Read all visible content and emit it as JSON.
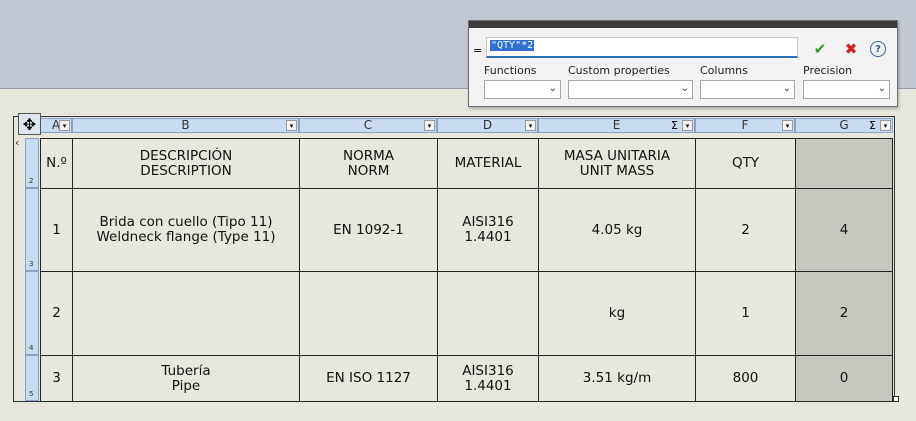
{
  "formula_bar": {
    "equals": "=",
    "expression": "\"QTY\"*2",
    "labels": {
      "functions": "Functions",
      "custom_properties": "Custom properties",
      "columns": "Columns",
      "precision": "Precision"
    },
    "buttons": {
      "ok": "✔",
      "cancel": "✖",
      "help": "?"
    }
  },
  "table": {
    "move_handle": "✥",
    "row_back_arrow": "‹",
    "columns": [
      {
        "letter": "A",
        "sigma": ""
      },
      {
        "letter": "B",
        "sigma": ""
      },
      {
        "letter": "C",
        "sigma": ""
      },
      {
        "letter": "D",
        "sigma": ""
      },
      {
        "letter": "E",
        "sigma": "Σ"
      },
      {
        "letter": "F",
        "sigma": ""
      },
      {
        "letter": "G",
        "sigma": "Σ"
      }
    ],
    "row_numbers": [
      "2",
      "3",
      "4",
      "5"
    ],
    "header": {
      "a": "N.º",
      "b1": "DESCRIPCIÓN",
      "b2": "DESCRIPTION",
      "c1": "NORMA",
      "c2": "NORM",
      "d": "MATERIAL",
      "e1": "MASA UNITARIA",
      "e2": "UNIT MASS",
      "f": "QTY",
      "g": ""
    },
    "rows": [
      {
        "a": "1",
        "b1": "Brida con cuello (Tipo 11)",
        "b2": "Weldneck flange (Type 11)",
        "c": "EN 1092-1",
        "d1": "AISI316",
        "d2": "1.4401",
        "e": "4.05 kg",
        "f": "2",
        "g": "4"
      },
      {
        "a": "2",
        "b1": "",
        "b2": "",
        "c": "",
        "d1": "",
        "d2": "",
        "e": "kg",
        "f": "1",
        "g": "2"
      },
      {
        "a": "3",
        "b1": "Tubería",
        "b2": "Pipe",
        "c": "EN ISO 1127",
        "d1": "AISI316",
        "d2": "1.4401",
        "e": "3.51 kg/m",
        "f": "800",
        "g": "0"
      }
    ]
  }
}
